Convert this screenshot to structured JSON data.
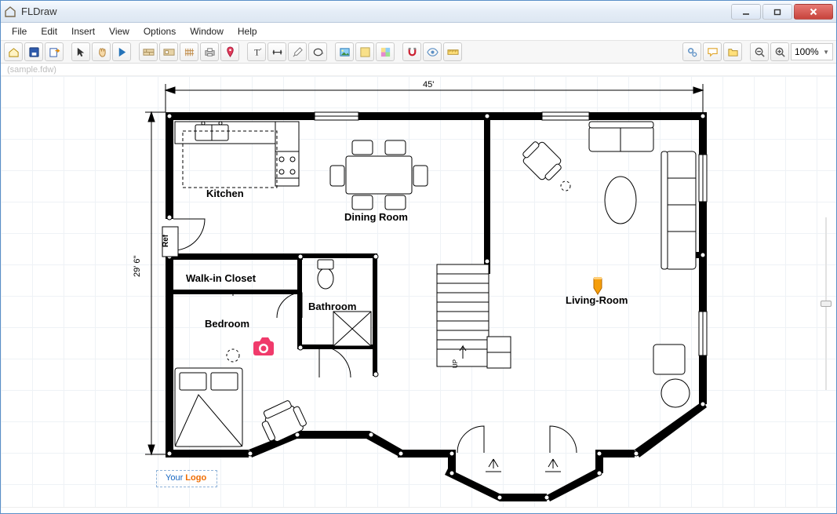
{
  "window": {
    "title": "FLDraw",
    "min_label": "Minimize",
    "max_label": "Restore",
    "close_label": "Close"
  },
  "menu": {
    "items": [
      "File",
      "Edit",
      "Insert",
      "View",
      "Options",
      "Window",
      "Help"
    ]
  },
  "toolbar": {
    "home_label": "Home",
    "save_label": "Save",
    "export_label": "Export",
    "select_label": "Select",
    "pan_label": "Pan",
    "play_label": "Play",
    "wall_label": "Wall tool",
    "door_label": "Door tool",
    "fence_label": "Fence",
    "print_label": "Print",
    "pin_label": "Marker",
    "text_label": "Text",
    "dim_label": "Dimension",
    "paint_label": "Paint",
    "circle_label": "Circle",
    "image_label": "Image",
    "color_label": "Color swatch",
    "colorpick_label": "Color picker",
    "magnet_label": "Snap",
    "eye_label": "Preview",
    "ruler_label": "Ruler",
    "gears_label": "Settings",
    "comment_label": "Comments",
    "folder_label": "Open folder",
    "zoomout_label": "Zoom out",
    "zoomin_label": "Zoom in",
    "zoom_value": "100%"
  },
  "document": {
    "filename": "(sample.fdw)"
  },
  "canvas": {
    "dim_width": "45'",
    "dim_height": "29' 6\"",
    "rooms": {
      "kitchen": "Kitchen",
      "dining": "Dining Room",
      "living": "Living-Room",
      "bedroom": "Bedroom",
      "bath": "Bathroom",
      "closet": "Walk-in Closet",
      "ref": "Ref"
    },
    "stairs_up": "UP",
    "logo_a": "Your ",
    "logo_b": "Logo",
    "camera_label": "Photo marker",
    "pin_marker_label": "Location pin"
  },
  "colors": {
    "accent_pink": "#f03a6b",
    "accent_orange": "#f59e0b"
  }
}
